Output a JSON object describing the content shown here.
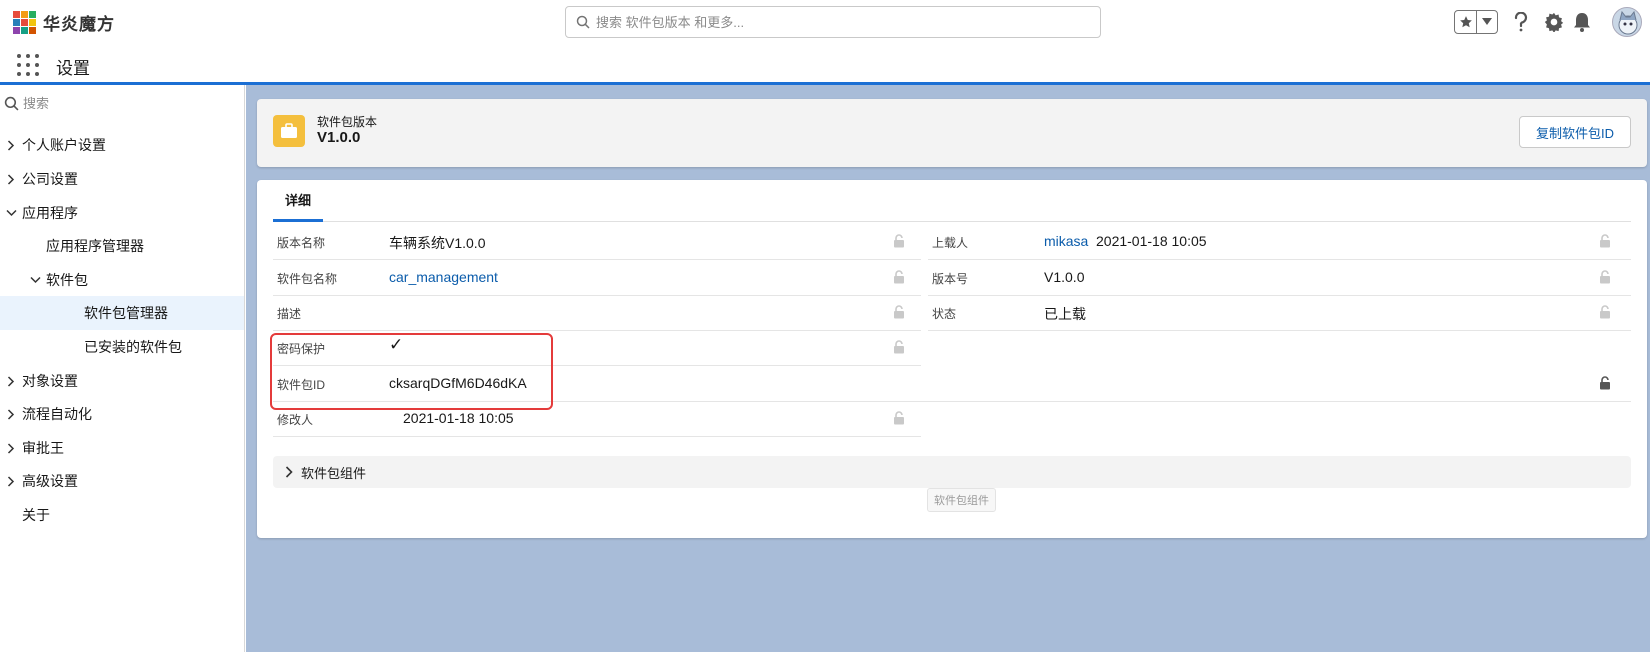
{
  "app": {
    "logo_text": "华炎魔方",
    "logo_colors": [
      "#e74c3c",
      "#f39c12",
      "#27ae60",
      "#2980b9",
      "#e74c3c",
      "#f1c40f",
      "#8e44ad",
      "#16a085",
      "#d35400"
    ],
    "search_placeholder": "搜索 软件包版本 和更多...",
    "subtitle": "设置",
    "accent": "#1b6fd4"
  },
  "sidebar": {
    "search_placeholder": "搜索",
    "items": [
      {
        "label": "个人账户设置",
        "level": 0,
        "expanded": false,
        "has_chevron": true
      },
      {
        "label": "公司设置",
        "level": 0,
        "expanded": false,
        "has_chevron": true
      },
      {
        "label": "应用程序",
        "level": 0,
        "expanded": true,
        "has_chevron": true
      },
      {
        "label": "应用程序管理器",
        "level": 1,
        "has_chevron": false
      },
      {
        "label": "软件包",
        "level": 1,
        "expanded": true,
        "has_chevron": true
      },
      {
        "label": "软件包管理器",
        "level": 2,
        "active": true,
        "has_chevron": false
      },
      {
        "label": "已安装的软件包",
        "level": 2,
        "has_chevron": false
      },
      {
        "label": "对象设置",
        "level": 0,
        "expanded": false,
        "has_chevron": true
      },
      {
        "label": "流程自动化",
        "level": 0,
        "expanded": false,
        "has_chevron": true
      },
      {
        "label": "审批王",
        "level": 0,
        "expanded": false,
        "has_chevron": true
      },
      {
        "label": "高级设置",
        "level": 0,
        "expanded": false,
        "has_chevron": true
      },
      {
        "label": "关于",
        "level": 0,
        "has_chevron": false
      }
    ]
  },
  "record": {
    "object_label": "软件包版本",
    "title": "V1.0.0",
    "copy_button": "复制软件包ID",
    "tab": "详细",
    "left_fields": [
      {
        "label": "版本名称",
        "value": "车辆系统V1.0.0",
        "link": false
      },
      {
        "label": "软件包名称",
        "value": "car_management",
        "link": true
      },
      {
        "label": "描述",
        "value": "",
        "link": false
      },
      {
        "label": "密码保护",
        "value": "✓",
        "link": false
      },
      {
        "label": "软件包ID",
        "value": "cksarqDGfM6D46dKA",
        "link": false
      },
      {
        "label": "修改人",
        "value": "2021-01-18 10:05",
        "link": false
      }
    ],
    "right_fields": [
      {
        "label": "上载人",
        "value_link": "mikasa",
        "value": "2021-01-18 10:05"
      },
      {
        "label": "版本号",
        "value": "V1.0.0"
      },
      {
        "label": "状态",
        "value": "已上载"
      }
    ],
    "section": "软件包组件",
    "tooltip": "软件包组件"
  }
}
